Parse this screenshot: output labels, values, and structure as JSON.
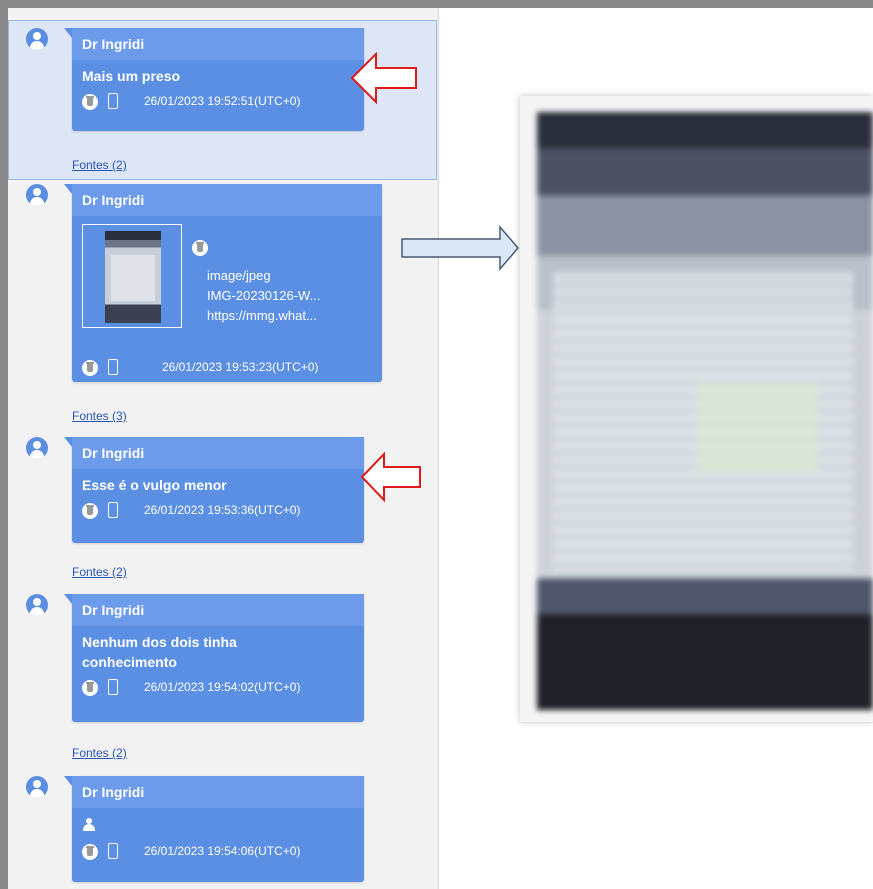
{
  "colors": {
    "bubble": "#5a8fe4",
    "bubble_header": "#6b9bea",
    "panel_bg": "#f2f2f2",
    "selected_bg": "#dde6f7",
    "link": "#2b55b5",
    "arrow_red": "#e01b1b",
    "arrow_blue_fill": "#dbe7f5"
  },
  "messages": [
    {
      "sender": "Dr Ingridi",
      "text": "Mais um preso",
      "timestamp": "26/01/2023 19:52:51(UTC+0)",
      "sources": "Fontes (2)"
    },
    {
      "sender": "Dr Ingridi",
      "attachment": {
        "mime": "image/jpeg",
        "filename": "IMG-20230126-W...",
        "url": "https://mmg.what..."
      },
      "timestamp": "26/01/2023 19:53:23(UTC+0)",
      "sources": "Fontes (3)"
    },
    {
      "sender": "Dr Ingridi",
      "text": "Esse é o vulgo menor",
      "timestamp": "26/01/2023 19:53:36(UTC+0)",
      "sources": "Fontes (2)"
    },
    {
      "sender": "Dr Ingridi",
      "text_line1": "Nenhum dos dois tinha",
      "text_line2": "conhecimento",
      "timestamp": "26/01/2023 19:54:02(UTC+0)",
      "sources": "Fontes (2)"
    },
    {
      "sender": "Dr Ingridi",
      "icon": "blank-contact-icon",
      "timestamp": "26/01/2023 19:54:06(UTC+0)"
    }
  ]
}
